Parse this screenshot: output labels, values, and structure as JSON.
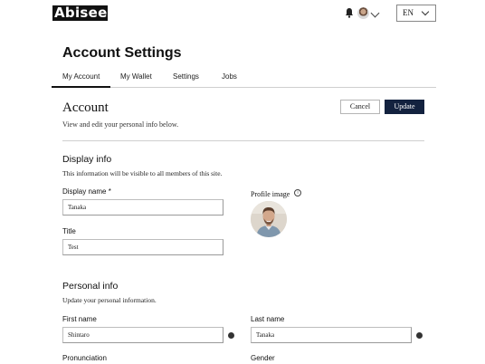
{
  "header": {
    "logo_text": "Abiseek",
    "language": "EN"
  },
  "page": {
    "title": "Account Settings",
    "tabs": [
      {
        "label": "My Account",
        "active": true
      },
      {
        "label": "My Wallet",
        "active": false
      },
      {
        "label": "Settings",
        "active": false
      },
      {
        "label": "Jobs",
        "active": false
      }
    ]
  },
  "account": {
    "title": "Account",
    "subtitle": "View and edit your personal info below.",
    "cancel_label": "Cancel",
    "update_label": "Update"
  },
  "display_info": {
    "title": "Display info",
    "description": "This information will be visible to all members of this site.",
    "display_name_label": "Display name *",
    "display_name_value": "Tanaka",
    "title_label": "Title",
    "title_value": "Test",
    "profile_image_label": "Profile image",
    "info_icon_glyph": "i"
  },
  "personal_info": {
    "title": "Personal info",
    "description": "Update your personal information.",
    "first_name_label": "First name",
    "first_name_value": "Shintaro",
    "last_name_label": "Last name",
    "last_name_value": "Tanaka",
    "pronunciation_label": "Pronunciation",
    "gender_label": "Gender"
  },
  "colors": {
    "primary_button": "#13223f",
    "text": "#1a1a1a",
    "divider": "#cfcfcf"
  },
  "icons": [
    "bell-icon",
    "avatar-icon",
    "chevron-down-icon",
    "globe-icon",
    "info-icon"
  ]
}
